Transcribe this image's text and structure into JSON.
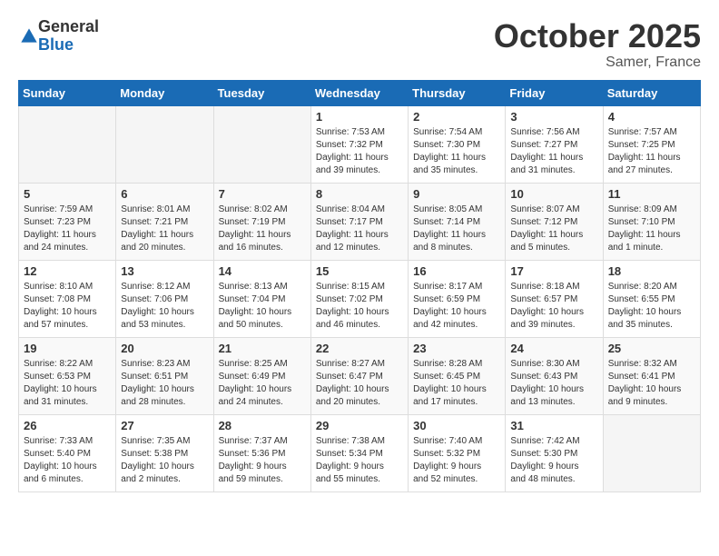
{
  "header": {
    "logo": {
      "general": "General",
      "blue": "Blue"
    },
    "title": "October 2025",
    "location": "Samer, France"
  },
  "weekdays": [
    "Sunday",
    "Monday",
    "Tuesday",
    "Wednesday",
    "Thursday",
    "Friday",
    "Saturday"
  ],
  "weeks": [
    [
      {
        "day": "",
        "info": ""
      },
      {
        "day": "",
        "info": ""
      },
      {
        "day": "",
        "info": ""
      },
      {
        "day": "1",
        "info": "Sunrise: 7:53 AM\nSunset: 7:32 PM\nDaylight: 11 hours\nand 39 minutes."
      },
      {
        "day": "2",
        "info": "Sunrise: 7:54 AM\nSunset: 7:30 PM\nDaylight: 11 hours\nand 35 minutes."
      },
      {
        "day": "3",
        "info": "Sunrise: 7:56 AM\nSunset: 7:27 PM\nDaylight: 11 hours\nand 31 minutes."
      },
      {
        "day": "4",
        "info": "Sunrise: 7:57 AM\nSunset: 7:25 PM\nDaylight: 11 hours\nand 27 minutes."
      }
    ],
    [
      {
        "day": "5",
        "info": "Sunrise: 7:59 AM\nSunset: 7:23 PM\nDaylight: 11 hours\nand 24 minutes."
      },
      {
        "day": "6",
        "info": "Sunrise: 8:01 AM\nSunset: 7:21 PM\nDaylight: 11 hours\nand 20 minutes."
      },
      {
        "day": "7",
        "info": "Sunrise: 8:02 AM\nSunset: 7:19 PM\nDaylight: 11 hours\nand 16 minutes."
      },
      {
        "day": "8",
        "info": "Sunrise: 8:04 AM\nSunset: 7:17 PM\nDaylight: 11 hours\nand 12 minutes."
      },
      {
        "day": "9",
        "info": "Sunrise: 8:05 AM\nSunset: 7:14 PM\nDaylight: 11 hours\nand 8 minutes."
      },
      {
        "day": "10",
        "info": "Sunrise: 8:07 AM\nSunset: 7:12 PM\nDaylight: 11 hours\nand 5 minutes."
      },
      {
        "day": "11",
        "info": "Sunrise: 8:09 AM\nSunset: 7:10 PM\nDaylight: 11 hours\nand 1 minute."
      }
    ],
    [
      {
        "day": "12",
        "info": "Sunrise: 8:10 AM\nSunset: 7:08 PM\nDaylight: 10 hours\nand 57 minutes."
      },
      {
        "day": "13",
        "info": "Sunrise: 8:12 AM\nSunset: 7:06 PM\nDaylight: 10 hours\nand 53 minutes."
      },
      {
        "day": "14",
        "info": "Sunrise: 8:13 AM\nSunset: 7:04 PM\nDaylight: 10 hours\nand 50 minutes."
      },
      {
        "day": "15",
        "info": "Sunrise: 8:15 AM\nSunset: 7:02 PM\nDaylight: 10 hours\nand 46 minutes."
      },
      {
        "day": "16",
        "info": "Sunrise: 8:17 AM\nSunset: 6:59 PM\nDaylight: 10 hours\nand 42 minutes."
      },
      {
        "day": "17",
        "info": "Sunrise: 8:18 AM\nSunset: 6:57 PM\nDaylight: 10 hours\nand 39 minutes."
      },
      {
        "day": "18",
        "info": "Sunrise: 8:20 AM\nSunset: 6:55 PM\nDaylight: 10 hours\nand 35 minutes."
      }
    ],
    [
      {
        "day": "19",
        "info": "Sunrise: 8:22 AM\nSunset: 6:53 PM\nDaylight: 10 hours\nand 31 minutes."
      },
      {
        "day": "20",
        "info": "Sunrise: 8:23 AM\nSunset: 6:51 PM\nDaylight: 10 hours\nand 28 minutes."
      },
      {
        "day": "21",
        "info": "Sunrise: 8:25 AM\nSunset: 6:49 PM\nDaylight: 10 hours\nand 24 minutes."
      },
      {
        "day": "22",
        "info": "Sunrise: 8:27 AM\nSunset: 6:47 PM\nDaylight: 10 hours\nand 20 minutes."
      },
      {
        "day": "23",
        "info": "Sunrise: 8:28 AM\nSunset: 6:45 PM\nDaylight: 10 hours\nand 17 minutes."
      },
      {
        "day": "24",
        "info": "Sunrise: 8:30 AM\nSunset: 6:43 PM\nDaylight: 10 hours\nand 13 minutes."
      },
      {
        "day": "25",
        "info": "Sunrise: 8:32 AM\nSunset: 6:41 PM\nDaylight: 10 hours\nand 9 minutes."
      }
    ],
    [
      {
        "day": "26",
        "info": "Sunrise: 7:33 AM\nSunset: 5:40 PM\nDaylight: 10 hours\nand 6 minutes."
      },
      {
        "day": "27",
        "info": "Sunrise: 7:35 AM\nSunset: 5:38 PM\nDaylight: 10 hours\nand 2 minutes."
      },
      {
        "day": "28",
        "info": "Sunrise: 7:37 AM\nSunset: 5:36 PM\nDaylight: 9 hours\nand 59 minutes."
      },
      {
        "day": "29",
        "info": "Sunrise: 7:38 AM\nSunset: 5:34 PM\nDaylight: 9 hours\nand 55 minutes."
      },
      {
        "day": "30",
        "info": "Sunrise: 7:40 AM\nSunset: 5:32 PM\nDaylight: 9 hours\nand 52 minutes."
      },
      {
        "day": "31",
        "info": "Sunrise: 7:42 AM\nSunset: 5:30 PM\nDaylight: 9 hours\nand 48 minutes."
      },
      {
        "day": "",
        "info": ""
      }
    ]
  ]
}
